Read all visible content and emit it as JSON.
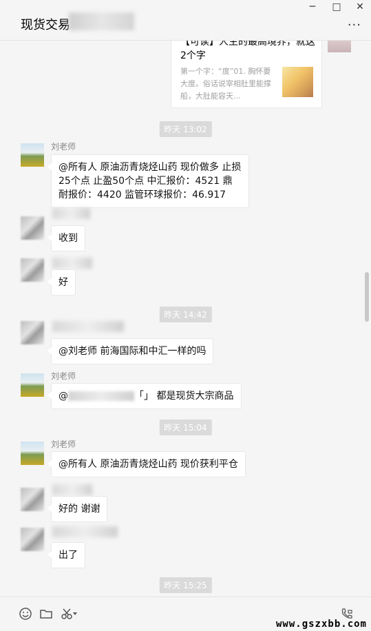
{
  "header": {
    "title": "现货交易",
    "win_min": "─",
    "win_max": "□",
    "win_close": "✕",
    "menu": "···"
  },
  "article": {
    "title": "【可读】人生的最高境界，就这2个字",
    "desc": "第一个字：“度”01. 胸怀要大度。俗话说宰相肚里能撑船，大肚能容天..."
  },
  "times": [
    "昨天 13:02",
    "昨天 14:42",
    "昨天 15:04",
    "昨天 15:25"
  ],
  "messages": [
    {
      "sender": "刘老师",
      "text": "@所有人 原油沥青烧烃山药 现价做多  止损25个点  止盈50个点   中汇报价：4521  鼎耐报价：4420  监管环球报价：46.917"
    },
    {
      "sender": "",
      "text": "收到"
    },
    {
      "sender": "",
      "text": "好"
    },
    {
      "sender": "",
      "text": "@刘老师 前海国际和中汇一样的吗"
    },
    {
      "sender": "刘老师",
      "text_a": "@",
      "text_b": "「」 都是现货大宗商品"
    },
    {
      "sender": "刘老师",
      "text": "@所有人 原油沥青烧烃山药 现价获利平仓"
    },
    {
      "sender": "",
      "text": "好的 谢谢"
    },
    {
      "sender": "",
      "text": "出了"
    }
  ],
  "icons": [
    "emoji-icon",
    "folder-icon",
    "scissors-icon",
    "phone-icon"
  ],
  "watermark": "www.gszxbb.com"
}
